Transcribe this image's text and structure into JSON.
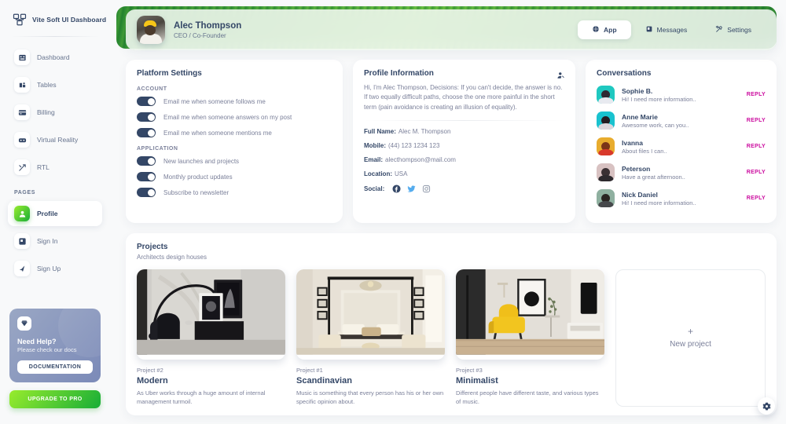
{
  "sidebar": {
    "brand": "Vite Soft UI Dashboard",
    "brand_icon": "dashboard-logo-icon",
    "items": [
      {
        "label": "Dashboard",
        "icon": "dashboard-icon",
        "active": false
      },
      {
        "label": "Tables",
        "icon": "tables-icon",
        "active": false
      },
      {
        "label": "Billing",
        "icon": "billing-icon",
        "active": false
      },
      {
        "label": "Virtual Reality",
        "icon": "vr-icon",
        "active": false
      },
      {
        "label": "RTL",
        "icon": "rtl-icon",
        "active": false
      }
    ],
    "section_label": "PAGES",
    "pages": [
      {
        "label": "Profile",
        "icon": "profile-icon",
        "active": true
      },
      {
        "label": "Sign In",
        "icon": "sign-in-icon",
        "active": false
      },
      {
        "label": "Sign Up",
        "icon": "sign-up-icon",
        "active": false
      }
    ],
    "help": {
      "icon": "diamond-icon",
      "title": "Need Help?",
      "subtitle": "Please check our docs",
      "button": "DOCUMENTATION"
    },
    "upgrade_button": "UPGRADE TO PRO"
  },
  "header": {
    "name": "Alec Thompson",
    "role": "CEO / Co-Founder",
    "avatar": "user-avatar",
    "tabs": [
      {
        "label": "App",
        "icon": "app-icon",
        "active": true
      },
      {
        "label": "Messages",
        "icon": "messages-icon",
        "active": false
      },
      {
        "label": "Settings",
        "icon": "settings-icon",
        "active": false
      }
    ]
  },
  "platform_settings": {
    "title": "Platform Settings",
    "account_label": "ACCOUNT",
    "account_items": [
      {
        "label": "Email me when someone follows me",
        "on": true
      },
      {
        "label": "Email me when someone answers on my post",
        "on": true
      },
      {
        "label": "Email me when someone mentions me",
        "on": true
      }
    ],
    "application_label": "APPLICATION",
    "application_items": [
      {
        "label": "New launches and projects",
        "on": true
      },
      {
        "label": "Monthly product updates",
        "on": true
      },
      {
        "label": "Subscribe to newsletter",
        "on": true
      }
    ]
  },
  "profile_information": {
    "title": "Profile Information",
    "edit_icon": "edit-profile-icon",
    "bio": "Hi, I'm Alec Thompson, Decisions: If you can't decide, the answer is no. If two equally difficult paths, choose the one more painful in the short term (pain avoidance is creating an illusion of equality).",
    "fields": [
      {
        "key": "Full Name:",
        "value": "Alec M. Thompson"
      },
      {
        "key": "Mobile:",
        "value": "(44) 123 1234 123"
      },
      {
        "key": "Email:",
        "value": "alecthompson@mail.com"
      },
      {
        "key": "Location:",
        "value": "USA"
      }
    ],
    "social_label": "Social:",
    "social": [
      {
        "icon": "facebook-icon",
        "color": "#344767"
      },
      {
        "icon": "twitter-icon",
        "color": "#55acee"
      },
      {
        "icon": "instagram-icon",
        "color": "#8a94a6"
      }
    ]
  },
  "conversations": {
    "title": "Conversations",
    "reply_label": "REPLY",
    "reply_color": "#cb0c9f",
    "items": [
      {
        "name": "Sophie B.",
        "message": "Hi! I need more information..",
        "avatar_bg": "#1fc8c0",
        "hair": "#2f2a33",
        "shirt": "#e8eaf0"
      },
      {
        "name": "Anne Marie",
        "message": "Awesome work, can you..",
        "avatar_bg": "#19c2cf",
        "hair": "#241d23",
        "shirt": "#ddd7dd"
      },
      {
        "name": "Ivanna",
        "message": "About files I can..",
        "avatar_bg": "#e8ac2e",
        "hair": "#7a3418",
        "shirt": "#d8392b"
      },
      {
        "name": "Peterson",
        "message": "Have a great afternoon..",
        "avatar_bg": "#d8c2c2",
        "hair": "#3a3033",
        "shirt": "#2e2a2e"
      },
      {
        "name": "Nick Daniel",
        "message": "Hi! I need more information..",
        "avatar_bg": "#8fb0a0",
        "hair": "#2a2422",
        "shirt": "#46484b"
      }
    ]
  },
  "projects": {
    "title": "Projects",
    "subtitle": "Architects design houses",
    "items": [
      {
        "number": "Project #2",
        "name": "Modern",
        "description": "As Uber works through a huge amount of internal management turmoil.",
        "image": "modern-interior-photo"
      },
      {
        "number": "Project #1",
        "name": "Scandinavian",
        "description": "Music is something that every person has his or her own specific opinion about.",
        "image": "scandinavian-bedroom-photo"
      },
      {
        "number": "Project #3",
        "name": "Minimalist",
        "description": "Different people have different taste, and various types of music.",
        "image": "minimalist-living-room-photo"
      }
    ],
    "new_project": {
      "plus": "+",
      "label": "New project"
    }
  },
  "fab": {
    "icon": "gear-icon"
  }
}
